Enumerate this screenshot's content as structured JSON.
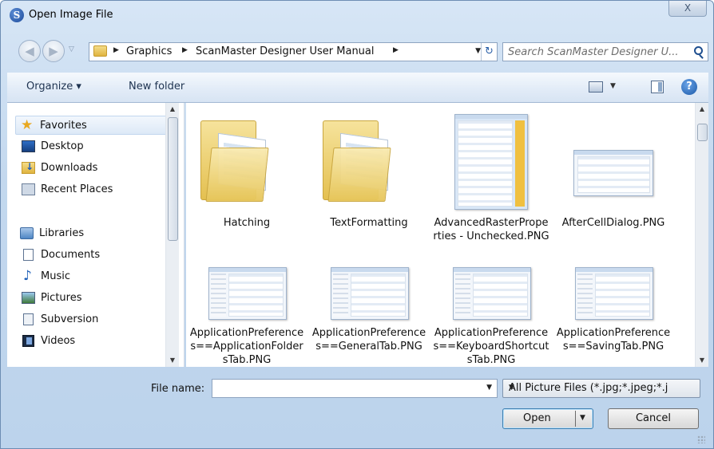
{
  "window": {
    "title": "Open Image File",
    "close_glyph": "X"
  },
  "address": {
    "crumbs": [
      "Graphics",
      "ScanMaster Designer User Manual"
    ]
  },
  "search": {
    "placeholder": "Search ScanMaster Designer U..."
  },
  "toolbar": {
    "organize_label": "Organize ▾",
    "new_folder_label": "New folder",
    "help_glyph": "?"
  },
  "navpane": {
    "favorites": {
      "label": "Favorites",
      "items": [
        {
          "label": "Desktop",
          "icon": "desktop-icon"
        },
        {
          "label": "Downloads",
          "icon": "downloads-icon"
        },
        {
          "label": "Recent Places",
          "icon": "recent-places-icon"
        }
      ]
    },
    "libraries": {
      "label": "Libraries",
      "items": [
        {
          "label": "Documents",
          "icon": "documents-icon"
        },
        {
          "label": "Music",
          "icon": "music-icon"
        },
        {
          "label": "Pictures",
          "icon": "pictures-icon"
        },
        {
          "label": "Subversion",
          "icon": "subversion-icon"
        },
        {
          "label": "Videos",
          "icon": "videos-icon"
        }
      ]
    }
  },
  "files": [
    {
      "name": "Hatching",
      "kind": "folder"
    },
    {
      "name": "TextFormatting",
      "kind": "folder"
    },
    {
      "name": "AdvancedRasterProperties - Unchecked.PNG",
      "kind": "image"
    },
    {
      "name": "AfterCellDialog.PNG",
      "kind": "image"
    },
    {
      "name": "ApplicationPreferences==ApplicationFoldersTab.PNG",
      "kind": "image"
    },
    {
      "name": "ApplicationPreferences==GeneralTab.PNG",
      "kind": "image"
    },
    {
      "name": "ApplicationPreferences==KeyboardShortcutsTab.PNG",
      "kind": "image"
    },
    {
      "name": "ApplicationPreferences==SavingTab.PNG",
      "kind": "image"
    }
  ],
  "bottom": {
    "file_name_label": "File name:",
    "file_name_value": "",
    "filter_label": "All Picture Files  (*.jpg;*.jpeg;*.j",
    "open_label": "Open",
    "cancel_label": "Cancel"
  },
  "colors": {
    "frame": "#bcd3ec",
    "accent": "#3c7fb1",
    "folder": "#e4c050"
  }
}
